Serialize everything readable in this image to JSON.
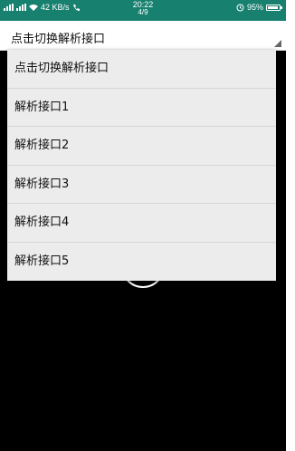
{
  "status_bar": {
    "network_speed": "42 KB/s",
    "time": "20:22",
    "counter": "4/9",
    "battery": "95%",
    "battery_level": 0.95,
    "background_color": "#17806f"
  },
  "spinner": {
    "selected_label": "点击切换解析接口"
  },
  "dropdown": {
    "items": [
      {
        "label": "点击切换解析接口"
      },
      {
        "label": "解析接口1"
      },
      {
        "label": "解析接口2"
      },
      {
        "label": "解析接口3"
      },
      {
        "label": "解析接口4"
      },
      {
        "label": "解析接口5"
      }
    ]
  },
  "icons": [
    "signal-icon",
    "wifi-icon",
    "call-icon",
    "alarm-icon",
    "battery-icon",
    "dropdown-arrow-icon",
    "loading-icon"
  ]
}
